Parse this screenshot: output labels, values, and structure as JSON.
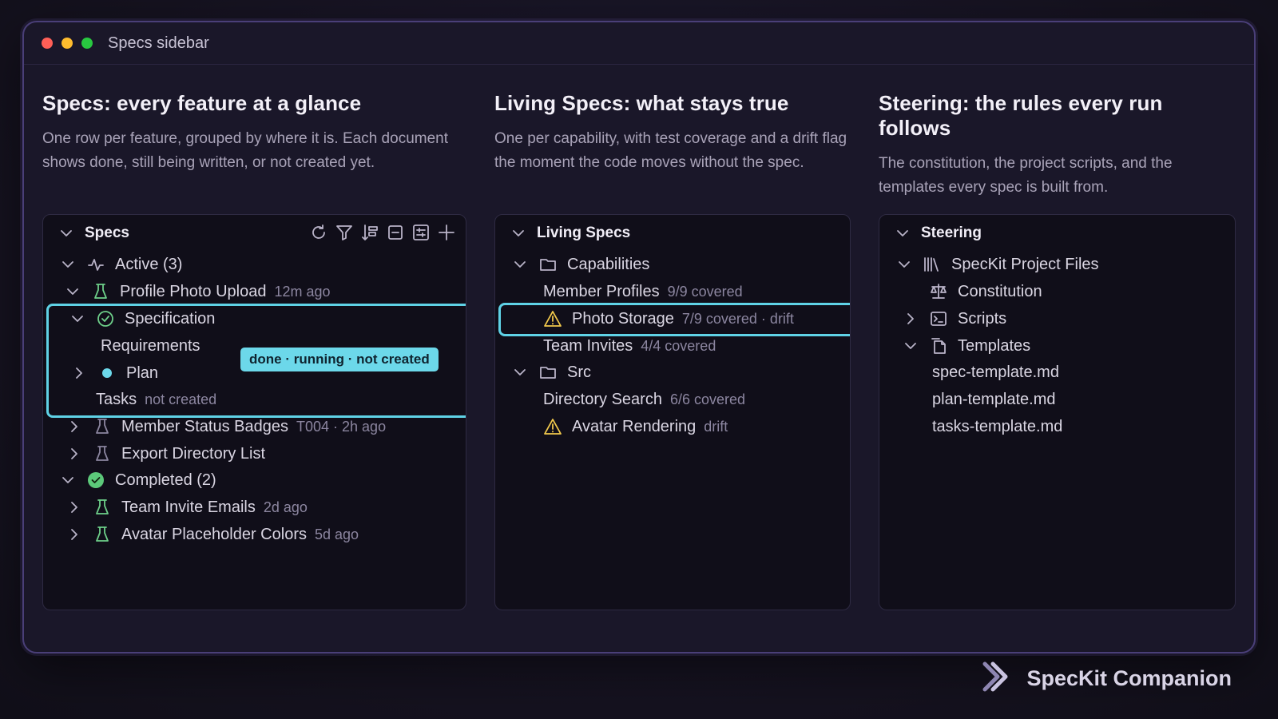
{
  "window": {
    "title": "Specs sidebar"
  },
  "columns": [
    {
      "heading": "Specs: every feature at a glance",
      "description": "One row per feature, grouped by where it is. Each document shows done, still being written, or not created yet."
    },
    {
      "heading": "Living Specs: what stays true",
      "description": "One per capability, with test coverage and a drift flag the moment the code moves without the spec."
    },
    {
      "heading": "Steering: the rules every run follows",
      "description": "The constitution, the project scripts, and the templates every spec is built from."
    }
  ],
  "specs_panel": {
    "header": "Specs",
    "toolbar_icons": [
      "refresh-icon",
      "filter-icon",
      "sort-icon",
      "collapse-all-icon",
      "settings-icon",
      "add-icon"
    ],
    "active_group": "Active (3)",
    "profile_photo": {
      "label": "Profile Photo Upload",
      "meta": "12m ago"
    },
    "specification": "Specification",
    "requirements": "Requirements",
    "plan": "Plan",
    "tasks": {
      "label": "Tasks",
      "meta": "not created"
    },
    "tooltip": "done · running · not created",
    "member_status": {
      "label": "Member Status Badges",
      "meta": "T004 · 2h ago"
    },
    "export_directory": {
      "label": "Export Directory List"
    },
    "completed_group": "Completed (2)",
    "team_invite": {
      "label": "Team Invite Emails",
      "meta": "2d ago"
    },
    "avatar_colors": {
      "label": "Avatar Placeholder Colors",
      "meta": "5d ago"
    }
  },
  "living_panel": {
    "header": "Living Specs",
    "capabilities": "Capabilities",
    "member_profiles": {
      "label": "Member Profiles",
      "meta": "9/9 covered"
    },
    "photo_storage": {
      "label": "Photo Storage",
      "meta": "7/9 covered · drift"
    },
    "team_invites": {
      "label": "Team Invites",
      "meta": "4/4 covered"
    },
    "src": "Src",
    "directory_search": {
      "label": "Directory Search",
      "meta": "6/6 covered"
    },
    "avatar_rendering": {
      "label": "Avatar Rendering",
      "meta": "drift"
    }
  },
  "steering_panel": {
    "header": "Steering",
    "project_files": "SpecKit Project Files",
    "constitution": "Constitution",
    "scripts": "Scripts",
    "templates": "Templates",
    "template_files": [
      "spec-template.md",
      "plan-template.md",
      "tasks-template.md"
    ]
  },
  "brand": {
    "name": "SpecKit Companion"
  },
  "colors": {
    "accent": "#5fd2e6",
    "success": "#5cc97a",
    "warning": "#f2c94c",
    "beaker_green": "#6ed08a",
    "muted": "#8c86a0"
  }
}
